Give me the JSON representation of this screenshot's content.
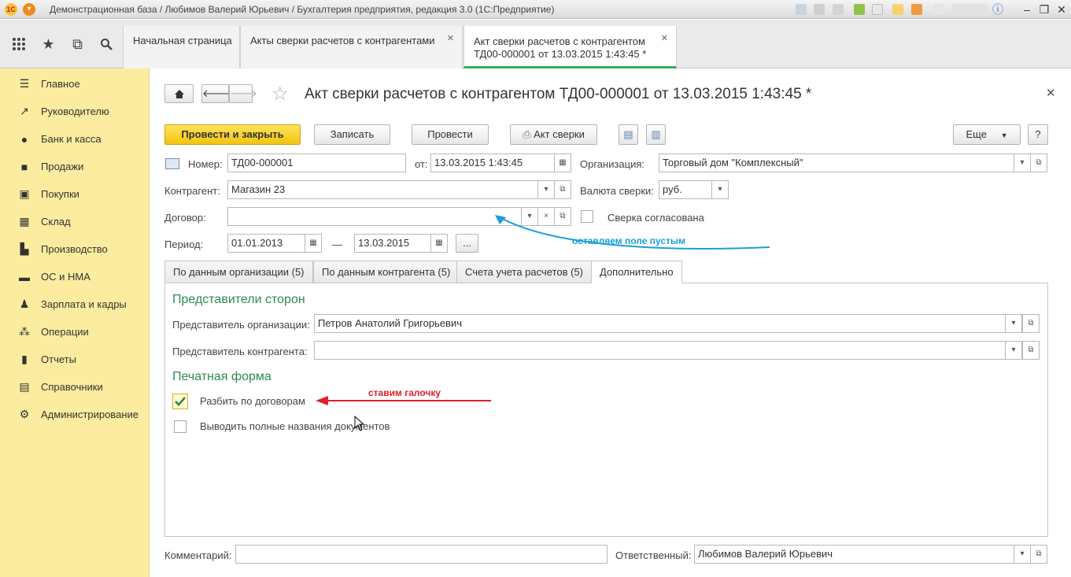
{
  "window": {
    "title": "Демонстрационная база / Любимов Валерий Юрьевич / Бухгалтерия предприятия, редакция 3.0  (1С:Предприятие)",
    "logo": "1С"
  },
  "top_tabs": [
    {
      "label": "Начальная страница"
    },
    {
      "label": "Акты сверки расчетов с контрагентами"
    },
    {
      "label_line1": "Акт сверки расчетов с контрагентом",
      "label_line2": "ТД00-000001 от 13.03.2015 1:43:45 *"
    }
  ],
  "sidebar": {
    "items": [
      {
        "label": "Главное",
        "icon": "menu-icon"
      },
      {
        "label": "Руководителю",
        "icon": "trend-icon"
      },
      {
        "label": "Банк и касса",
        "icon": "coin-icon"
      },
      {
        "label": "Продажи",
        "icon": "bag-icon"
      },
      {
        "label": "Покупки",
        "icon": "cart-icon"
      },
      {
        "label": "Склад",
        "icon": "box-icon"
      },
      {
        "label": "Производство",
        "icon": "factory-icon"
      },
      {
        "label": "ОС и НМА",
        "icon": "car-icon"
      },
      {
        "label": "Зарплата и кадры",
        "icon": "people-icon"
      },
      {
        "label": "Операции",
        "icon": "operations-icon"
      },
      {
        "label": "Отчеты",
        "icon": "bar-chart-icon"
      },
      {
        "label": "Справочники",
        "icon": "book-icon"
      },
      {
        "label": "Администрирование",
        "icon": "gear-icon"
      }
    ]
  },
  "document": {
    "title": "Акт сверки расчетов с контрагентом ТД00-000001 от 13.03.2015 1:43:45 *",
    "toolbar": {
      "post_close": "Провести и закрыть",
      "save": "Записать",
      "post": "Провести",
      "print_act": "Акт сверки",
      "more": "Еще",
      "help": "?"
    },
    "fields": {
      "number_label": "Номер:",
      "number": "ТД00-000001",
      "date_label": "от:",
      "date": "13.03.2015  1:43:45",
      "org_label": "Организация:",
      "org": "Торговый дом \"Комплексный\"",
      "counterparty_label": "Контрагент:",
      "counterparty": "Магазин 23",
      "currency_label": "Валюта сверки:",
      "currency": "руб.",
      "contract_label": "Договор:",
      "contract": "",
      "agreed_label": "Сверка согласована",
      "period_label": "Период:",
      "period_from": "01.01.2013",
      "period_dash": "—",
      "period_to": "13.03.2015",
      "period_btn": "..."
    },
    "tabs": [
      {
        "label": "По данным организации (5)"
      },
      {
        "label": "По данным контрагента (5)"
      },
      {
        "label": "Счета учета расчетов (5)"
      },
      {
        "label": "Дополнительно"
      }
    ],
    "extra": {
      "reps_title": "Представители сторон",
      "org_rep_label": "Представитель организации:",
      "org_rep": "Петров Анатолий Григорьевич",
      "cp_rep_label": "Представитель контрагента:",
      "cp_rep": "",
      "print_title": "Печатная форма",
      "split_label": "Разбить по договорам",
      "split_checked": true,
      "full_names_label": "Выводить полные названия документов",
      "full_names_checked": false
    },
    "footer": {
      "comment_label": "Комментарий:",
      "comment": "",
      "responsible_label": "Ответственный:",
      "responsible": "Любимов Валерий Юрьевич"
    }
  },
  "annotations": {
    "blue_note": "оставляем поле пустым",
    "red_note": "ставим галочку",
    "blue_color": "#1a9fd9",
    "red_color": "#e0202a"
  }
}
